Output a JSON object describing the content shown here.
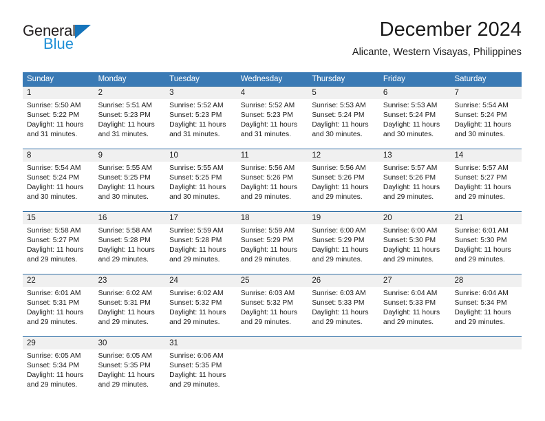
{
  "brand": {
    "name_primary": "General",
    "name_secondary": "Blue",
    "triangle_color": "#1574bb",
    "blue_color": "#1f8fd6"
  },
  "header": {
    "month_title": "December 2024",
    "location": "Alicante, Western Visayas, Philippines"
  },
  "theme": {
    "header_bar_color": "#3a7ab5",
    "week_divider_color": "#2e6da4",
    "daynum_band_color": "#f0f0f0",
    "text_color": "#1a1a1a"
  },
  "weekdays": [
    "Sunday",
    "Monday",
    "Tuesday",
    "Wednesday",
    "Thursday",
    "Friday",
    "Saturday"
  ],
  "weeks": [
    {
      "daynums": [
        "1",
        "2",
        "3",
        "4",
        "5",
        "6",
        "7"
      ],
      "days": [
        {
          "sunrise": "Sunrise: 5:50 AM",
          "sunset": "Sunset: 5:22 PM",
          "daylight1": "Daylight: 11 hours",
          "daylight2": "and 31 minutes."
        },
        {
          "sunrise": "Sunrise: 5:51 AM",
          "sunset": "Sunset: 5:23 PM",
          "daylight1": "Daylight: 11 hours",
          "daylight2": "and 31 minutes."
        },
        {
          "sunrise": "Sunrise: 5:52 AM",
          "sunset": "Sunset: 5:23 PM",
          "daylight1": "Daylight: 11 hours",
          "daylight2": "and 31 minutes."
        },
        {
          "sunrise": "Sunrise: 5:52 AM",
          "sunset": "Sunset: 5:23 PM",
          "daylight1": "Daylight: 11 hours",
          "daylight2": "and 31 minutes."
        },
        {
          "sunrise": "Sunrise: 5:53 AM",
          "sunset": "Sunset: 5:24 PM",
          "daylight1": "Daylight: 11 hours",
          "daylight2": "and 30 minutes."
        },
        {
          "sunrise": "Sunrise: 5:53 AM",
          "sunset": "Sunset: 5:24 PM",
          "daylight1": "Daylight: 11 hours",
          "daylight2": "and 30 minutes."
        },
        {
          "sunrise": "Sunrise: 5:54 AM",
          "sunset": "Sunset: 5:24 PM",
          "daylight1": "Daylight: 11 hours",
          "daylight2": "and 30 minutes."
        }
      ]
    },
    {
      "daynums": [
        "8",
        "9",
        "10",
        "11",
        "12",
        "13",
        "14"
      ],
      "days": [
        {
          "sunrise": "Sunrise: 5:54 AM",
          "sunset": "Sunset: 5:24 PM",
          "daylight1": "Daylight: 11 hours",
          "daylight2": "and 30 minutes."
        },
        {
          "sunrise": "Sunrise: 5:55 AM",
          "sunset": "Sunset: 5:25 PM",
          "daylight1": "Daylight: 11 hours",
          "daylight2": "and 30 minutes."
        },
        {
          "sunrise": "Sunrise: 5:55 AM",
          "sunset": "Sunset: 5:25 PM",
          "daylight1": "Daylight: 11 hours",
          "daylight2": "and 30 minutes."
        },
        {
          "sunrise": "Sunrise: 5:56 AM",
          "sunset": "Sunset: 5:26 PM",
          "daylight1": "Daylight: 11 hours",
          "daylight2": "and 29 minutes."
        },
        {
          "sunrise": "Sunrise: 5:56 AM",
          "sunset": "Sunset: 5:26 PM",
          "daylight1": "Daylight: 11 hours",
          "daylight2": "and 29 minutes."
        },
        {
          "sunrise": "Sunrise: 5:57 AM",
          "sunset": "Sunset: 5:26 PM",
          "daylight1": "Daylight: 11 hours",
          "daylight2": "and 29 minutes."
        },
        {
          "sunrise": "Sunrise: 5:57 AM",
          "sunset": "Sunset: 5:27 PM",
          "daylight1": "Daylight: 11 hours",
          "daylight2": "and 29 minutes."
        }
      ]
    },
    {
      "daynums": [
        "15",
        "16",
        "17",
        "18",
        "19",
        "20",
        "21"
      ],
      "days": [
        {
          "sunrise": "Sunrise: 5:58 AM",
          "sunset": "Sunset: 5:27 PM",
          "daylight1": "Daylight: 11 hours",
          "daylight2": "and 29 minutes."
        },
        {
          "sunrise": "Sunrise: 5:58 AM",
          "sunset": "Sunset: 5:28 PM",
          "daylight1": "Daylight: 11 hours",
          "daylight2": "and 29 minutes."
        },
        {
          "sunrise": "Sunrise: 5:59 AM",
          "sunset": "Sunset: 5:28 PM",
          "daylight1": "Daylight: 11 hours",
          "daylight2": "and 29 minutes."
        },
        {
          "sunrise": "Sunrise: 5:59 AM",
          "sunset": "Sunset: 5:29 PM",
          "daylight1": "Daylight: 11 hours",
          "daylight2": "and 29 minutes."
        },
        {
          "sunrise": "Sunrise: 6:00 AM",
          "sunset": "Sunset: 5:29 PM",
          "daylight1": "Daylight: 11 hours",
          "daylight2": "and 29 minutes."
        },
        {
          "sunrise": "Sunrise: 6:00 AM",
          "sunset": "Sunset: 5:30 PM",
          "daylight1": "Daylight: 11 hours",
          "daylight2": "and 29 minutes."
        },
        {
          "sunrise": "Sunrise: 6:01 AM",
          "sunset": "Sunset: 5:30 PM",
          "daylight1": "Daylight: 11 hours",
          "daylight2": "and 29 minutes."
        }
      ]
    },
    {
      "daynums": [
        "22",
        "23",
        "24",
        "25",
        "26",
        "27",
        "28"
      ],
      "days": [
        {
          "sunrise": "Sunrise: 6:01 AM",
          "sunset": "Sunset: 5:31 PM",
          "daylight1": "Daylight: 11 hours",
          "daylight2": "and 29 minutes."
        },
        {
          "sunrise": "Sunrise: 6:02 AM",
          "sunset": "Sunset: 5:31 PM",
          "daylight1": "Daylight: 11 hours",
          "daylight2": "and 29 minutes."
        },
        {
          "sunrise": "Sunrise: 6:02 AM",
          "sunset": "Sunset: 5:32 PM",
          "daylight1": "Daylight: 11 hours",
          "daylight2": "and 29 minutes."
        },
        {
          "sunrise": "Sunrise: 6:03 AM",
          "sunset": "Sunset: 5:32 PM",
          "daylight1": "Daylight: 11 hours",
          "daylight2": "and 29 minutes."
        },
        {
          "sunrise": "Sunrise: 6:03 AM",
          "sunset": "Sunset: 5:33 PM",
          "daylight1": "Daylight: 11 hours",
          "daylight2": "and 29 minutes."
        },
        {
          "sunrise": "Sunrise: 6:04 AM",
          "sunset": "Sunset: 5:33 PM",
          "daylight1": "Daylight: 11 hours",
          "daylight2": "and 29 minutes."
        },
        {
          "sunrise": "Sunrise: 6:04 AM",
          "sunset": "Sunset: 5:34 PM",
          "daylight1": "Daylight: 11 hours",
          "daylight2": "and 29 minutes."
        }
      ]
    },
    {
      "daynums": [
        "29",
        "30",
        "31",
        "",
        "",
        "",
        ""
      ],
      "days": [
        {
          "sunrise": "Sunrise: 6:05 AM",
          "sunset": "Sunset: 5:34 PM",
          "daylight1": "Daylight: 11 hours",
          "daylight2": "and 29 minutes."
        },
        {
          "sunrise": "Sunrise: 6:05 AM",
          "sunset": "Sunset: 5:35 PM",
          "daylight1": "Daylight: 11 hours",
          "daylight2": "and 29 minutes."
        },
        {
          "sunrise": "Sunrise: 6:06 AM",
          "sunset": "Sunset: 5:35 PM",
          "daylight1": "Daylight: 11 hours",
          "daylight2": "and 29 minutes."
        },
        {
          "sunrise": "",
          "sunset": "",
          "daylight1": "",
          "daylight2": ""
        },
        {
          "sunrise": "",
          "sunset": "",
          "daylight1": "",
          "daylight2": ""
        },
        {
          "sunrise": "",
          "sunset": "",
          "daylight1": "",
          "daylight2": ""
        },
        {
          "sunrise": "",
          "sunset": "",
          "daylight1": "",
          "daylight2": ""
        }
      ]
    }
  ]
}
